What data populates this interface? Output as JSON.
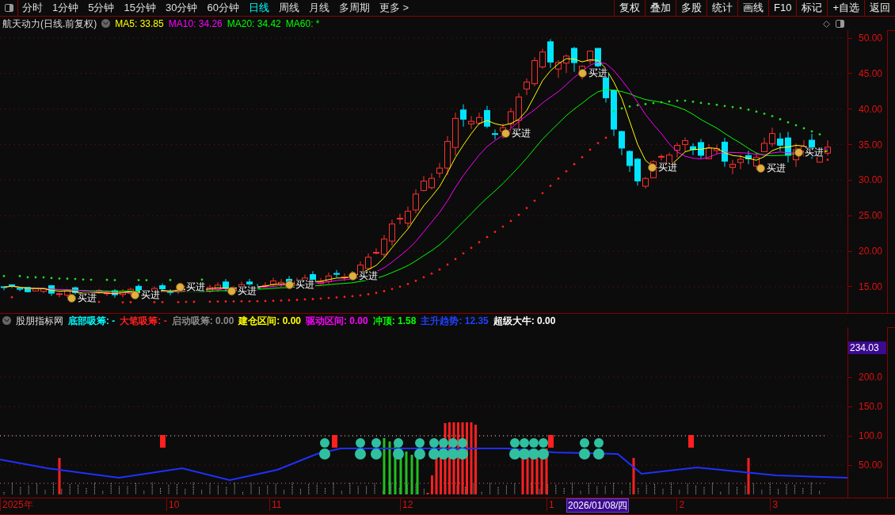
{
  "toolbar": {
    "periods": [
      {
        "label": "分时",
        "selected": false
      },
      {
        "label": "1分钟",
        "selected": false
      },
      {
        "label": "5分钟",
        "selected": false
      },
      {
        "label": "15分钟",
        "selected": false
      },
      {
        "label": "30分钟",
        "selected": false
      },
      {
        "label": "60分钟",
        "selected": false
      },
      {
        "label": "日线",
        "selected": true
      },
      {
        "label": "周线",
        "selected": false
      },
      {
        "label": "月线",
        "selected": false
      },
      {
        "label": "多周期",
        "selected": false
      },
      {
        "label": "更多 >",
        "selected": false
      }
    ],
    "buttons": [
      "复权",
      "叠加",
      "多股",
      "统计",
      "画线",
      "F10",
      "标记",
      "+自选",
      "返回"
    ]
  },
  "main_chart": {
    "title": "航天动力(日线.前复权)",
    "moving_averages": [
      {
        "text": "MA5: 33.85",
        "color": "#ffff00"
      },
      {
        "text": "MA10: 34.26",
        "color": "#ff00ff"
      },
      {
        "text": "MA20: 34.42",
        "color": "#00ff00"
      },
      {
        "text": "MA60: *",
        "color": "#00ff00"
      }
    ],
    "signals": [
      {
        "label": "买进"
      },
      {
        "label": "买进"
      },
      {
        "label": "买进"
      },
      {
        "label": "买进"
      },
      {
        "label": "买进"
      },
      {
        "label": "买进"
      },
      {
        "label": "买进"
      },
      {
        "label": "买进"
      },
      {
        "label": "买进"
      },
      {
        "label": "买进"
      },
      {
        "label": "买进"
      }
    ],
    "price_axis": [
      "50.00",
      "45.00",
      "40.00",
      "35.00",
      "30.00",
      "25.00",
      "20.00",
      "15.00"
    ]
  },
  "indicator": {
    "name": "股朋指标网",
    "values": [
      {
        "text": "底部吸筹: -",
        "color": "#00ffff"
      },
      {
        "text": "大笔吸筹: -",
        "color": "#ff2020"
      },
      {
        "text": "启动吸筹: 0.00",
        "color": "#8a8a8a"
      },
      {
        "text": "建仓区间: 0.00",
        "color": "#ffff00"
      },
      {
        "text": "驱动区间: 0.00",
        "color": "#ff00ff"
      },
      {
        "text": "冲顶: 1.58",
        "color": "#00ff00"
      },
      {
        "text": "主升趋势: 12.35",
        "color": "#2040ff"
      },
      {
        "text": "超级大牛: 0.00",
        "color": "#ffffff"
      }
    ],
    "current_value": "234.03",
    "axis": [
      "200.0",
      "150.0",
      "100.0",
      "50.00"
    ]
  },
  "date_axis": [
    {
      "text": "2025年",
      "kind": "month"
    },
    {
      "text": "10",
      "kind": "month"
    },
    {
      "text": "11",
      "kind": "month"
    },
    {
      "text": "12",
      "kind": "month"
    },
    {
      "text": "1",
      "kind": "month"
    },
    {
      "text": "2026/01/08/四",
      "kind": "cursor"
    },
    {
      "text": "2",
      "kind": "month"
    },
    {
      "text": "3",
      "kind": "month"
    }
  ]
}
